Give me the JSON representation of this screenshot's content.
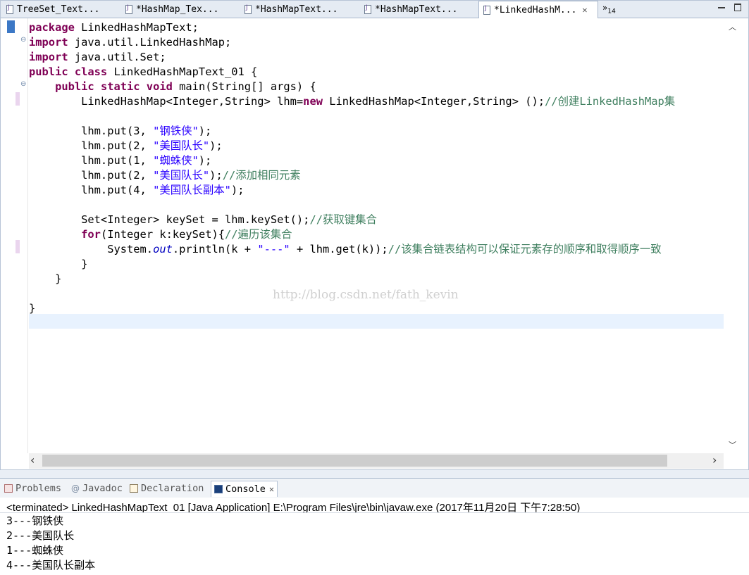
{
  "tabs": [
    {
      "label": "TreeSet_Text...",
      "active": false,
      "closable": false
    },
    {
      "label": "*HashMap_Tex...",
      "active": false,
      "closable": false
    },
    {
      "label": "*HashMapText...",
      "active": false,
      "closable": false
    },
    {
      "label": "*HashMapText...",
      "active": false,
      "closable": false
    },
    {
      "label": "*LinkedHashM...",
      "active": true,
      "closable": true
    }
  ],
  "tab_overflow": {
    "glyph": "»",
    "count": "14"
  },
  "code_lines": [
    [
      {
        "t": "package",
        "c": "kw"
      },
      {
        "t": " LinkedHashMapText;",
        "c": ""
      }
    ],
    [
      {
        "t": "import",
        "c": "kw"
      },
      {
        "t": " java.util.LinkedHashMap;",
        "c": ""
      }
    ],
    [
      {
        "t": "import",
        "c": "kw"
      },
      {
        "t": " java.util.Set;",
        "c": ""
      }
    ],
    [
      {
        "t": "public class",
        "c": "kw"
      },
      {
        "t": " LinkedHashMapText_01 {",
        "c": ""
      }
    ],
    [
      {
        "t": "    ",
        "c": ""
      },
      {
        "t": "public static void",
        "c": "kw"
      },
      {
        "t": " main(String[] args) {",
        "c": ""
      }
    ],
    [
      {
        "t": "        LinkedHashMap<Integer,String> lhm=",
        "c": ""
      },
      {
        "t": "new",
        "c": "kw"
      },
      {
        "t": " LinkedHashMap<Integer,String> ();",
        "c": ""
      },
      {
        "t": "//创建LinkedHashMap集",
        "c": "cmt"
      }
    ],
    [],
    [
      {
        "t": "        lhm.put(3, ",
        "c": ""
      },
      {
        "t": "\"钢铁侠\"",
        "c": "str"
      },
      {
        "t": ");",
        "c": ""
      }
    ],
    [
      {
        "t": "        lhm.put(2, ",
        "c": ""
      },
      {
        "t": "\"美国队长\"",
        "c": "str"
      },
      {
        "t": ");",
        "c": ""
      }
    ],
    [
      {
        "t": "        lhm.put(1, ",
        "c": ""
      },
      {
        "t": "\"蜘蛛侠\"",
        "c": "str"
      },
      {
        "t": ");",
        "c": ""
      }
    ],
    [
      {
        "t": "        lhm.put(2, ",
        "c": ""
      },
      {
        "t": "\"美国队长\"",
        "c": "str"
      },
      {
        "t": ");",
        "c": ""
      },
      {
        "t": "//添加相同元素",
        "c": "cmt"
      }
    ],
    [
      {
        "t": "        lhm.put(4, ",
        "c": ""
      },
      {
        "t": "\"美国队长副本\"",
        "c": "str"
      },
      {
        "t": ");",
        "c": ""
      }
    ],
    [],
    [
      {
        "t": "        Set<Integer> keySet = lhm.keySet();",
        "c": ""
      },
      {
        "t": "//获取键集合",
        "c": "cmt"
      }
    ],
    [
      {
        "t": "        ",
        "c": ""
      },
      {
        "t": "for",
        "c": "kw"
      },
      {
        "t": "(Integer k:keySet){",
        "c": ""
      },
      {
        "t": "//遍历该集合",
        "c": "cmt"
      }
    ],
    [
      {
        "t": "            System.",
        "c": ""
      },
      {
        "t": "out",
        "c": "fld"
      },
      {
        "t": ".println(k + ",
        "c": ""
      },
      {
        "t": "\"---\"",
        "c": "str"
      },
      {
        "t": " + lhm.get(k));",
        "c": ""
      },
      {
        "t": "//该集合链表结构可以保证元素存的顺序和取得顺序一致",
        "c": "cmt"
      }
    ],
    [
      {
        "t": "        }",
        "c": ""
      }
    ],
    [
      {
        "t": "    }",
        "c": ""
      }
    ],
    [],
    [
      {
        "t": "}",
        "c": ""
      }
    ]
  ],
  "watermark": "http://blog.csdn.net/fath_kevin",
  "views": [
    {
      "label": "Problems",
      "icon": "problems-icon",
      "active": false
    },
    {
      "label": "Javadoc",
      "icon": "javadoc-icon",
      "active": false
    },
    {
      "label": "Declaration",
      "icon": "declaration-icon",
      "active": false
    },
    {
      "label": "Console",
      "icon": "console-icon",
      "active": true
    }
  ],
  "console": {
    "terminated": "<terminated> LinkedHashMapText_01 [Java Application] E:\\Program Files\\jre\\bin\\javaw.exe (2017年11月20日 下午7:28:50)",
    "output": [
      "3---钢铁侠",
      "2---美国队长",
      "1---蜘蛛侠",
      "4---美国队长副本"
    ]
  }
}
